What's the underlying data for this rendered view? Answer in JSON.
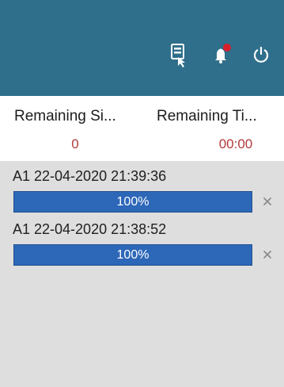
{
  "colors": {
    "topbar": "#2f6f8b",
    "list_background": "#dedede",
    "summary_value": "#b23a3a",
    "progress_fill": "#2d67b8",
    "remove_icon": "#8c8c8c"
  },
  "toolbar": {
    "icons": [
      "export-icon",
      "bell-icon",
      "power-icon"
    ]
  },
  "summary": {
    "remaining_size_label": "Remaining Si...",
    "remaining_time_label": "Remaining Ti...",
    "remaining_size_value": "0",
    "remaining_time_value": "00:00"
  },
  "tasks": [
    {
      "title": "A1 22-04-2020 21:39:36",
      "progress_text": "100%",
      "progress_percent": 100
    },
    {
      "title": "A1 22-04-2020 21:38:52",
      "progress_text": "100%",
      "progress_percent": 100
    }
  ]
}
